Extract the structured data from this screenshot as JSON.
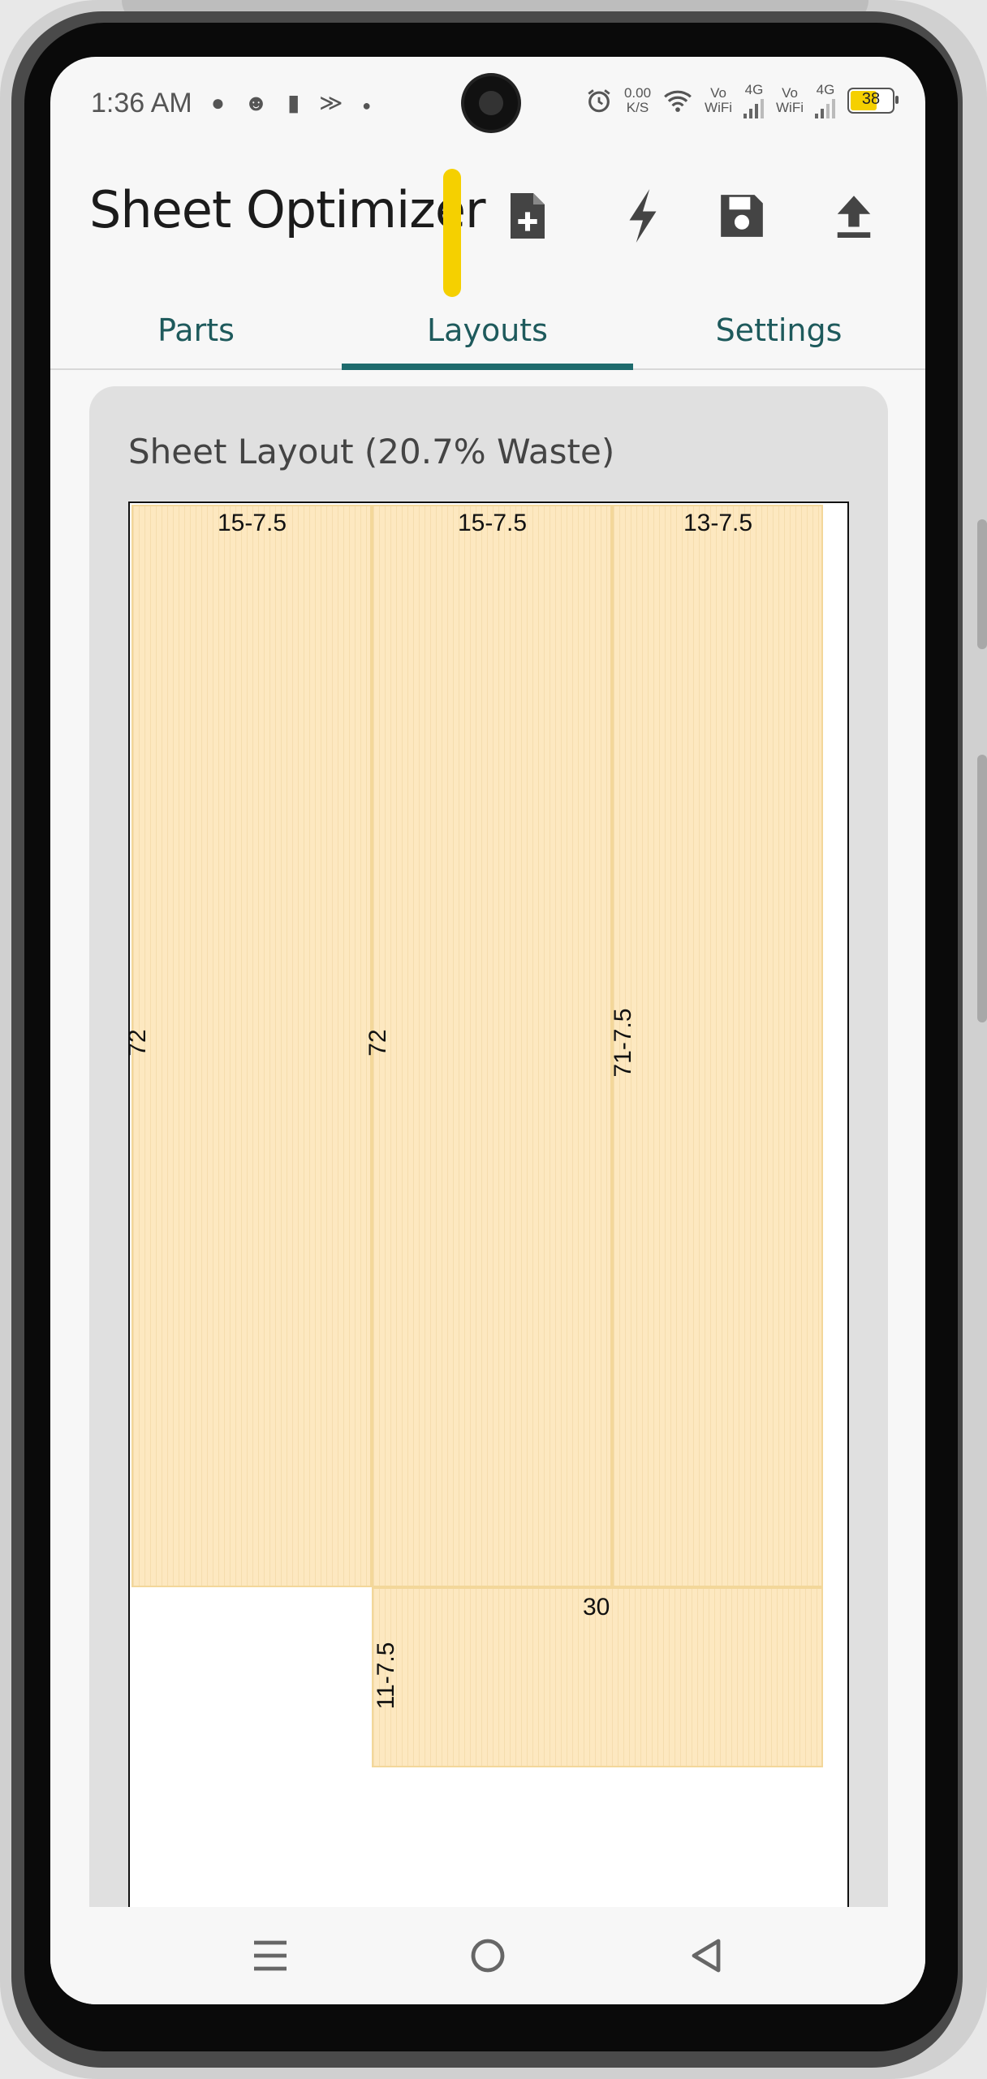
{
  "status_bar": {
    "time": "1:36 AM",
    "left_icons": [
      "chat-icon",
      "face-icon",
      "sim-card-icon",
      "activity-icon",
      "dot-icon"
    ],
    "net_speed_top": "0.00",
    "net_speed_bottom": "K/S",
    "vo_label_1": "Vo",
    "wifi_label_1": "WiFi",
    "lte_label_1": "4G",
    "vo_label_2": "Vo",
    "wifi_label_2": "WiFi",
    "lte_label_2": "4G",
    "battery": "38"
  },
  "app_bar": {
    "title": "Sheet Optimizer",
    "actions": [
      "new-file-icon",
      "lightning-icon",
      "save-icon",
      "upload-icon"
    ]
  },
  "tabs": [
    {
      "label": "Parts",
      "selected": false
    },
    {
      "label": "Layouts",
      "selected": true
    },
    {
      "label": "Settings",
      "selected": false
    }
  ],
  "layout": {
    "title": "Sheet Layout (20.7% Waste)",
    "parts": [
      {
        "width_label": "15-7.5",
        "height_label": "72"
      },
      {
        "width_label": "15-7.5",
        "height_label": "72"
      },
      {
        "width_label": "13-7.5",
        "height_label": "71-7.5"
      },
      {
        "width_label": "30",
        "height_label": "11-7.5"
      }
    ]
  },
  "colors": {
    "accent": "#1e6b6d",
    "part_fill": "#fde8c0",
    "highlight": "#f5d000"
  },
  "nav": [
    "recents-icon",
    "home-icon",
    "back-icon"
  ]
}
